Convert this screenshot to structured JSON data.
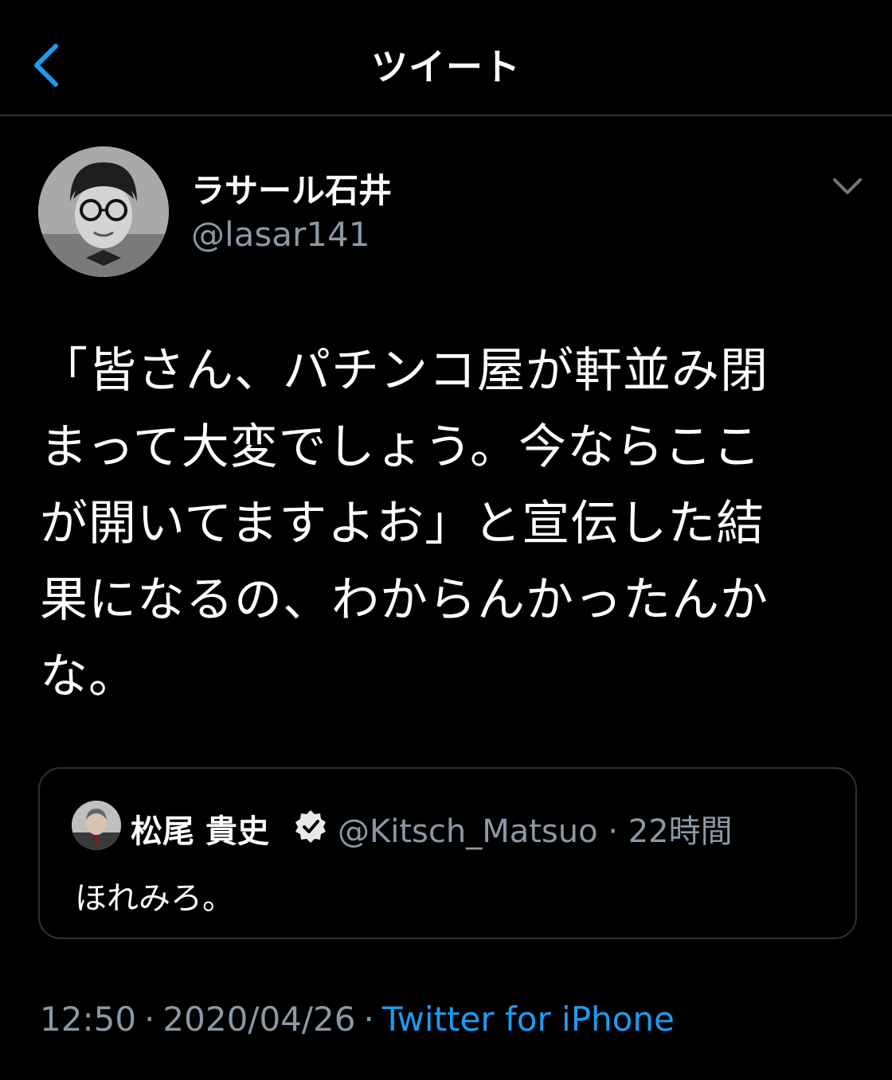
{
  "header": {
    "title": "ツイート"
  },
  "author": {
    "name": "ラサール石井",
    "handle": "@lasar141"
  },
  "tweet": {
    "lines": [
      "「皆さん、パチンコ屋が軒並み閉",
      "まって大変でしょう。今ならここ",
      "が開いてますよお」と宣伝した結",
      "果になるの、わからんかったんか",
      "な。"
    ]
  },
  "quote": {
    "name": "松尾 貴史",
    "meta": "@Kitsch_Matsuo · 22時間",
    "text": "ほれみろ。"
  },
  "footer": {
    "time": "12:50",
    "separator": "·",
    "date": "2020/04/26",
    "source": "Twitter for iPhone"
  },
  "colors": {
    "background": "#000000",
    "accent": "#1d9bf0",
    "secondary_text": "#8b98a5",
    "border": "#2f3336"
  }
}
